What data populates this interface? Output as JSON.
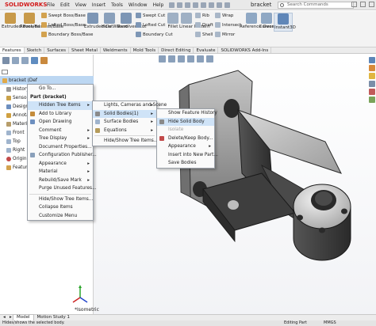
{
  "app": {
    "logo": "SOLIDWORKS",
    "menu": [
      "File",
      "Edit",
      "View",
      "Insert",
      "Tools",
      "Window",
      "Help"
    ],
    "doc_title": "bracket",
    "search_placeholder": "Search Commands"
  },
  "ribbon": {
    "extruded_boss": "Extruded Boss/Base",
    "revolved_boss": "Revolved Boss/Base",
    "swept_boss": "Swept Boss/Base",
    "lofted_boss": "Lofted Boss/Base",
    "boundary_boss": "Boundary Boss/Base",
    "extruded_cut": "Extruded Cut",
    "hole_wizard": "Hole Wizard",
    "revolved_cut": "Revolved Cut",
    "swept_cut": "Swept Cut",
    "lofted_cut": "Lofted Cut",
    "boundary_cut": "Boundary Cut",
    "fillet": "Fillet",
    "linear_pattern": "Linear Pattern",
    "rib": "Rib",
    "draft": "Draft",
    "shell": "Shell",
    "wrap": "Wrap",
    "intersect": "Intersect",
    "mirror": "Mirror",
    "reference_geometry": "Reference Geometry",
    "curves": "Curves",
    "instant3d": "Instant3D"
  },
  "command_tabs": [
    "Features",
    "Sketch",
    "Surfaces",
    "Sheet Metal",
    "Weldments",
    "Mold Tools",
    "Direct Editing",
    "Evaluate",
    "SOLIDWORKS Add-Ins"
  ],
  "tree": {
    "root": "bracket  (Def",
    "items": [
      "History",
      "Sensors",
      "Design",
      "Annotat",
      "Material",
      "Front",
      "Top",
      "Right",
      "Origin",
      "Feature"
    ]
  },
  "context_menu": {
    "goto": "Go To...",
    "header": "Part (bracket)",
    "items": [
      {
        "label": "Hidden Tree Items",
        "arrow": true,
        "hi": true
      },
      {
        "label": "Add to Library",
        "arrow": false
      },
      {
        "label": "Open Drawing",
        "arrow": false
      },
      {
        "label": "Comment",
        "arrow": true
      },
      {
        "label": "Tree Display",
        "arrow": true
      },
      {
        "label": "Document Properties...",
        "arrow": false
      },
      {
        "label": "Configuration Publisher...",
        "arrow": false
      },
      {
        "label": "Appearance",
        "arrow": true
      },
      {
        "label": "Material",
        "arrow": true
      },
      {
        "label": "Rebuild/Save Mark",
        "arrow": true
      },
      {
        "label": "Purge Unused Features...",
        "arrow": false
      },
      {
        "label": "Hide/Show Tree Items...",
        "arrow": false
      },
      {
        "label": "Collapse Items",
        "arrow": false
      },
      {
        "label": "Customize Menu",
        "arrow": false
      }
    ]
  },
  "submenu1": {
    "items": [
      {
        "label": "Lights, Cameras and Scene",
        "arrow": true
      },
      {
        "label": "Solid Bodies(1)",
        "arrow": true,
        "hi": true
      },
      {
        "label": "Surface Bodies",
        "arrow": true
      },
      {
        "label": "Equations",
        "arrow": true
      },
      {
        "label": "Hide/Show Tree Items...",
        "arrow": false
      }
    ]
  },
  "submenu2": {
    "items": [
      {
        "label": "Show Feature History",
        "disabled": false
      },
      {
        "label": "Hide Solid Body",
        "disabled": false
      },
      {
        "label": "Isolate",
        "disabled": true
      },
      {
        "label": "Delete/Keep Body...",
        "disabled": false
      },
      {
        "label": "Appearance",
        "disabled": false,
        "arrow": true
      },
      {
        "label": "Insert into New Part...",
        "disabled": false
      },
      {
        "label": "Save Bodies",
        "disabled": false
      }
    ]
  },
  "view": {
    "orientation": "*Isometric"
  },
  "bottom_tabs": [
    "Model",
    "Motion Study 1"
  ],
  "status": {
    "left": "Hides/shows the selected body.",
    "editing": "Editing Part",
    "units": "MMGS"
  }
}
